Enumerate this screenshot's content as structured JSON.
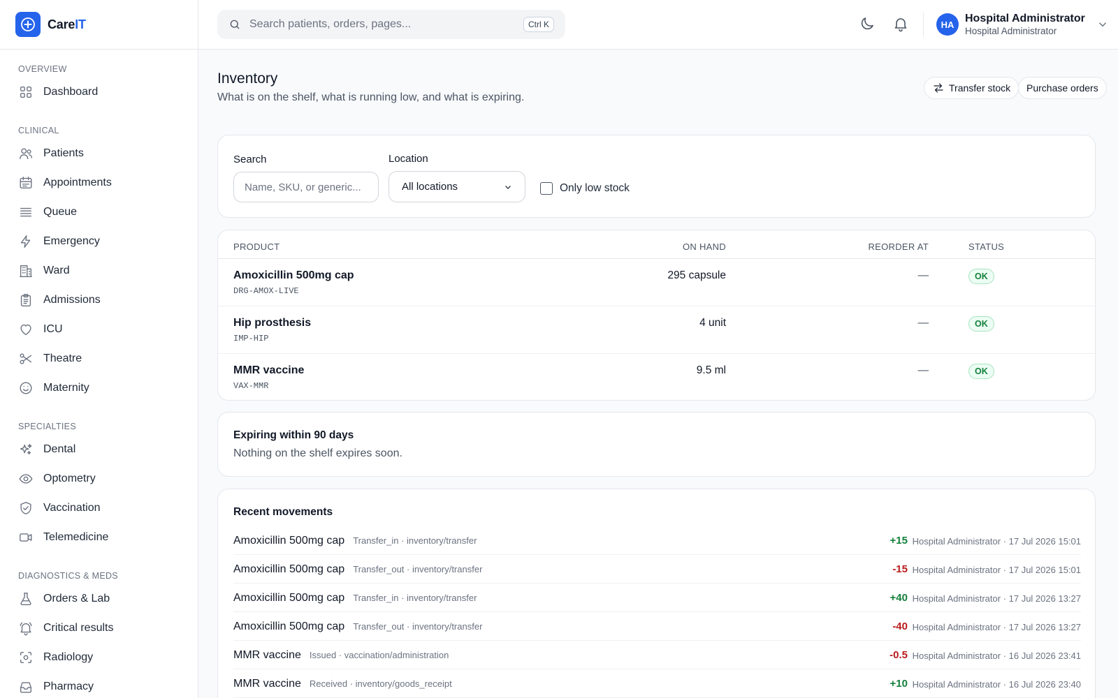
{
  "brand": {
    "name_main": "Care",
    "name_accent": "IT"
  },
  "sidebar": {
    "sections": [
      {
        "title": "OVERVIEW",
        "items": [
          {
            "label": "Dashboard",
            "icon": "grid-icon"
          }
        ]
      },
      {
        "title": "CLINICAL",
        "items": [
          {
            "label": "Patients",
            "icon": "users-icon"
          },
          {
            "label": "Appointments",
            "icon": "calendar-icon"
          },
          {
            "label": "Queue",
            "icon": "list-icon"
          },
          {
            "label": "Emergency",
            "icon": "bolt-icon"
          },
          {
            "label": "Ward",
            "icon": "building-icon"
          },
          {
            "label": "Admissions",
            "icon": "clipboard-icon"
          },
          {
            "label": "ICU",
            "icon": "heart-icon"
          },
          {
            "label": "Theatre",
            "icon": "scissors-icon"
          },
          {
            "label": "Maternity",
            "icon": "smile-icon"
          }
        ]
      },
      {
        "title": "SPECIALTIES",
        "items": [
          {
            "label": "Dental",
            "icon": "sparkles-icon"
          },
          {
            "label": "Optometry",
            "icon": "eye-icon"
          },
          {
            "label": "Vaccination",
            "icon": "shield-check-icon"
          },
          {
            "label": "Telemedicine",
            "icon": "video-icon"
          }
        ]
      },
      {
        "title": "DIAGNOSTICS & MEDS",
        "items": [
          {
            "label": "Orders & Lab",
            "icon": "flask-icon"
          },
          {
            "label": "Critical results",
            "icon": "bell-alert-icon"
          },
          {
            "label": "Radiology",
            "icon": "scan-icon"
          },
          {
            "label": "Pharmacy",
            "icon": "inbox-icon"
          }
        ]
      }
    ]
  },
  "topbar": {
    "search_placeholder": "Search patients, orders, pages...",
    "shortcut": "Ctrl K",
    "user": {
      "initials": "HA",
      "name": "Hospital Administrator",
      "role": "Hospital Administrator"
    }
  },
  "page": {
    "title": "Inventory",
    "subtitle": "What is on the shelf, what is running low, and what is expiring.",
    "actions": {
      "transfer": "Transfer stock",
      "purchase": "Purchase orders"
    }
  },
  "filters": {
    "search_label": "Search",
    "search_placeholder": "Name, SKU, or generic...",
    "location_label": "Location",
    "location_value": "All locations",
    "low_stock_label": "Only low stock",
    "low_stock_checked": false
  },
  "table": {
    "headers": {
      "product": "PRODUCT",
      "on_hand": "ON HAND",
      "reorder_at": "REORDER AT",
      "status": "STATUS"
    },
    "rows": [
      {
        "name": "Amoxicillin 500mg cap",
        "sku": "DRG-AMOX-LIVE",
        "on_hand": "295 capsule",
        "reorder_at": "—",
        "status": "OK"
      },
      {
        "name": "Hip prosthesis",
        "sku": "IMP-HIP",
        "on_hand": "4 unit",
        "reorder_at": "—",
        "status": "OK"
      },
      {
        "name": "MMR vaccine",
        "sku": "VAX-MMR",
        "on_hand": "9.5 ml",
        "reorder_at": "—",
        "status": "OK"
      }
    ]
  },
  "expiring": {
    "title": "Expiring within 90 days",
    "message": "Nothing on the shelf expires soon."
  },
  "movements": {
    "title": "Recent movements",
    "rows": [
      {
        "product": "Amoxicillin 500mg cap",
        "meta": "Transfer_in · inventory/transfer",
        "qty": "+15",
        "who": "Hospital Administrator · 17 Jul 2026 15:01"
      },
      {
        "product": "Amoxicillin 500mg cap",
        "meta": "Transfer_out · inventory/transfer",
        "qty": "-15",
        "who": "Hospital Administrator · 17 Jul 2026 15:01"
      },
      {
        "product": "Amoxicillin 500mg cap",
        "meta": "Transfer_in · inventory/transfer",
        "qty": "+40",
        "who": "Hospital Administrator · 17 Jul 2026 13:27"
      },
      {
        "product": "Amoxicillin 500mg cap",
        "meta": "Transfer_out · inventory/transfer",
        "qty": "-40",
        "who": "Hospital Administrator · 17 Jul 2026 13:27"
      },
      {
        "product": "MMR vaccine",
        "meta": "Issued · vaccination/administration",
        "qty": "-0.5",
        "who": "Hospital Administrator · 16 Jul 2026 23:41"
      },
      {
        "product": "MMR vaccine",
        "meta": "Received · inventory/goods_receipt",
        "qty": "+10",
        "who": "Hospital Administrator · 16 Jul 2026 23:40"
      }
    ]
  },
  "colors": {
    "accent": "#2563eb",
    "positive": "#15803d",
    "negative": "#b91c1c"
  }
}
